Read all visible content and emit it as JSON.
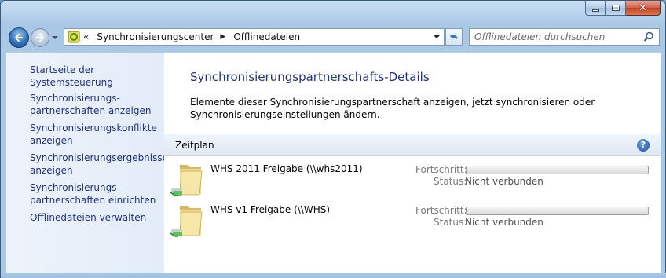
{
  "address": {
    "chevrons": "«",
    "breadcrumbs": [
      "Synchronisierungscenter",
      "Offlinedateien"
    ]
  },
  "search": {
    "placeholder": "Offlinedateien durchsuchen"
  },
  "sidebar": {
    "items": [
      {
        "label": "Startseite der Systemsteuerung"
      },
      {
        "label": "Synchronisierungs-\npartnerschaften anzeigen"
      },
      {
        "label": "Synchronisierungskonflikte\nanzeigen"
      },
      {
        "label": "Synchronisierungsergebnisse\nanzeigen"
      },
      {
        "label": "Synchronisierungs-\npartnerschaften einrichten"
      },
      {
        "label": "Offlinedateien verwalten"
      }
    ]
  },
  "main": {
    "title": "Synchronisierungspartnerschafts-Details",
    "description": "Elemente dieser Synchronisierungspartnerschaft anzeigen, jetzt synchronisieren oder Synchronisierungseinstellungen ändern.",
    "section_title": "Zeitplan",
    "help_symbol": "?",
    "partners": [
      {
        "name": "WHS 2011 Freigabe (\\\\whs2011)",
        "progress_label": "Fortschritt:",
        "progress": 0,
        "status_label": "Status:",
        "status": "Nicht verbunden"
      },
      {
        "name": "WHS v1 Freigabe (\\\\WHS)",
        "progress_label": "Fortschritt:",
        "progress": 0,
        "status_label": "Status:",
        "status": "Nicht verbunden"
      }
    ]
  },
  "icons": {
    "back": "back-arrow-icon",
    "forward": "forward-arrow-icon",
    "folder": "sync-folder-icon",
    "search": "search-icon",
    "help": "help-icon",
    "refresh": "refresh-icon"
  },
  "colors": {
    "link": "#1e3287",
    "title": "#1e3287",
    "muted": "#7a7a7a"
  }
}
